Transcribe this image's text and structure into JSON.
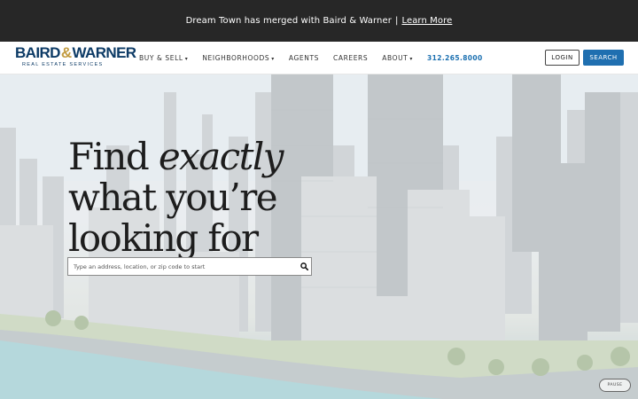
{
  "announcement": {
    "text": "Dream Town has merged with Baird & Warner",
    "separator": "|",
    "link": "Learn More"
  },
  "brand": {
    "left": "BAIRD",
    "amp": "&",
    "right": "WARNER",
    "tagline": "REAL ESTATE SERVICES",
    "color": "#0d3b66",
    "accent": "#c29b40"
  },
  "nav": {
    "items": [
      {
        "label": "BUY & SELL",
        "caret": "▾"
      },
      {
        "label": "NEIGHBORHOODS",
        "caret": "▾"
      },
      {
        "label": "AGENTS",
        "caret": ""
      },
      {
        "label": "CAREERS",
        "caret": ""
      },
      {
        "label": "ABOUT",
        "caret": "▾"
      }
    ],
    "phone": "312.265.8000",
    "login": "LOGIN",
    "search": "SEARCH",
    "accent": "#1f6fb0"
  },
  "hero": {
    "headline_1": "Find",
    "headline_1_em": "exactly",
    "headline_2": "what you’re",
    "headline_3": "looking for",
    "search_placeholder": "Type an address, location, or zip code to start",
    "search_icon": "magnifier-icon",
    "pause": "PAUSE"
  }
}
